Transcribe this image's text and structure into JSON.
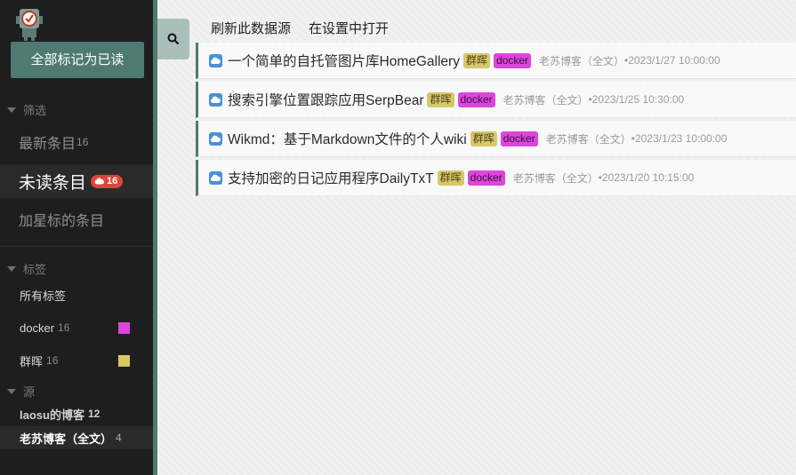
{
  "sidebar": {
    "mark_all_label": "全部标记为已读",
    "filter_header": "筛选",
    "nav": [
      {
        "label": "最新条目",
        "count": "16"
      },
      {
        "label": "未读条目",
        "count": "16"
      },
      {
        "label": "加星标的条目"
      }
    ],
    "tags_header": "标签",
    "tags_all": "所有标签",
    "tags": [
      {
        "label": "docker",
        "count": "16",
        "color": "#dd45dc"
      },
      {
        "label": "群晖",
        "count": "16",
        "color": "#d8c867"
      }
    ],
    "sources_header": "源",
    "sources": [
      {
        "label": "laosu的博客",
        "count": "12"
      },
      {
        "label": "老苏博客（全文）",
        "count": "4"
      }
    ]
  },
  "toolbar": {
    "refresh_label": "刷新此数据源",
    "open_settings_label": "在设置中打开"
  },
  "colors": {
    "accent": "#4f7a72",
    "unread_badge": "#e2443d",
    "tag_docker": "#dd45dc",
    "tag_qunhui": "#d8c867"
  },
  "entries": [
    {
      "title": "一个简单的自托管图片库HomeGallery",
      "tag1": "群晖",
      "tag2": "docker",
      "source": "老苏博客（全文）",
      "date": "•2023/1/27 10:00:00"
    },
    {
      "title": "搜索引擎位置跟踪应用SerpBear",
      "tag1": "群晖",
      "tag2": "docker",
      "source": "老苏博客（全文）",
      "date": "•2023/1/25 10:30:00"
    },
    {
      "title": "Wikmd：基于Markdown文件的个人wiki",
      "tag1": "群晖",
      "tag2": "docker",
      "source": "老苏博客（全文）",
      "date": "•2023/1/23 10:00:00"
    },
    {
      "title": "支持加密的日记应用程序DailyTxT",
      "tag1": "群晖",
      "tag2": "docker",
      "source": "老苏博客（全文）",
      "date": "•2023/1/20 10:15:00"
    }
  ]
}
